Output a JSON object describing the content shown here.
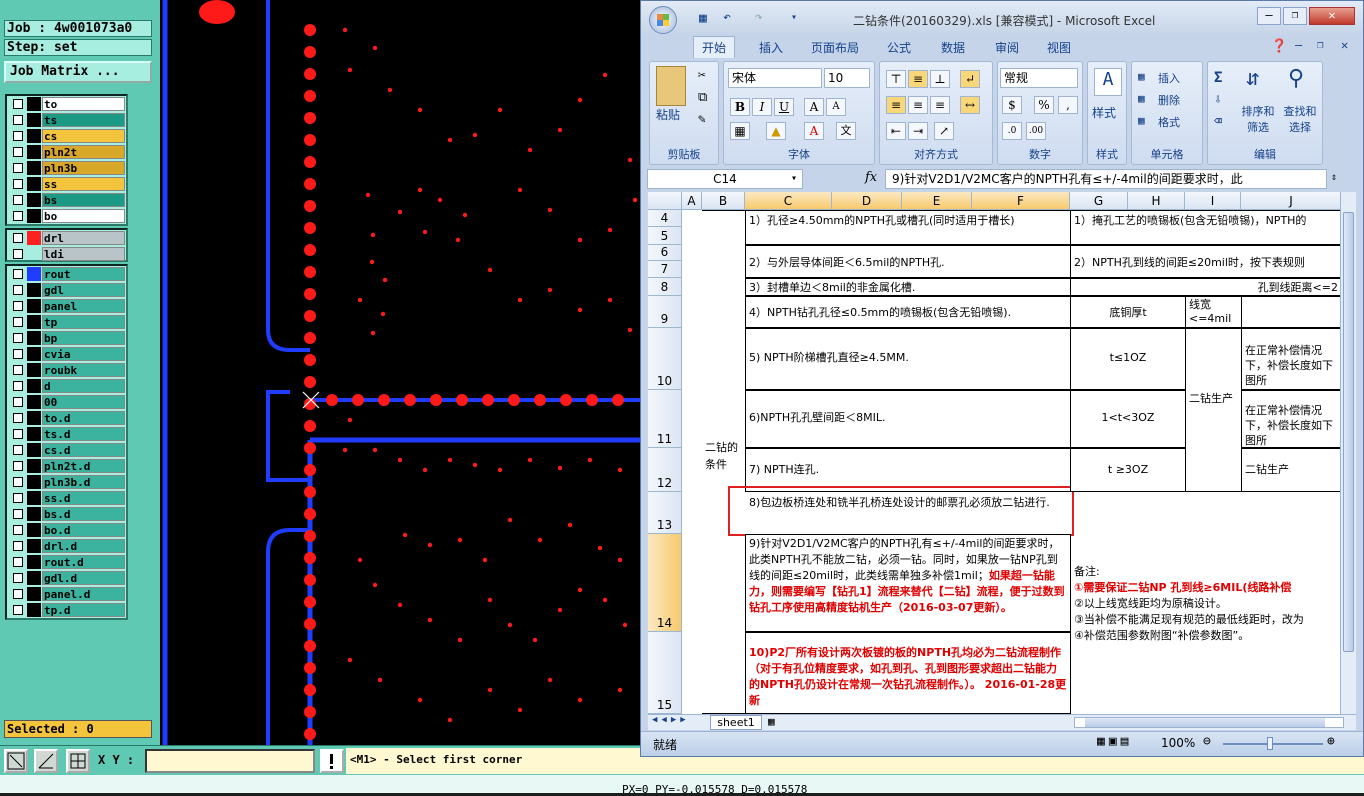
{
  "left_panel": {
    "job": "Job : 4w001073a0",
    "step": "Step: set",
    "job_matrix": "Job Matrix ...",
    "group1": [
      {
        "name": "to",
        "color": "#ffffff"
      },
      {
        "name": "ts",
        "color": "#1c9a86"
      },
      {
        "name": "cs",
        "color": "#f3c43c"
      },
      {
        "name": "pln2t",
        "color": "#d9a72a"
      },
      {
        "name": "pln3b",
        "color": "#d9a72a"
      },
      {
        "name": "ss",
        "color": "#f3c43c"
      },
      {
        "name": "bs",
        "color": "#1c9a86"
      },
      {
        "name": "bo",
        "color": "#ffffff"
      }
    ],
    "group2": [
      {
        "name": "drl",
        "swatch": "#ff2020"
      },
      {
        "name": "ldi",
        "swatch": ""
      }
    ],
    "group3": [
      "rout",
      "gdl",
      "panel",
      "tp",
      "bp",
      "cvia",
      "roubk",
      "d",
      "00",
      "to.d",
      "ts.d",
      "cs.d",
      "pln2t.d",
      "pln3b.d",
      "ss.d",
      "bs.d",
      "bo.d",
      "drl.d",
      "rout.d",
      "gdl.d",
      "panel.d",
      "tp.d"
    ],
    "selected": "Selected : 0"
  },
  "bottom_bar": {
    "xy_label": "X Y :",
    "xy_value": "",
    "prompt": "<M1> - Select first corner",
    "status": "PX=0 PY=-0.015578 D=0.015578"
  },
  "excel": {
    "title": "二钻条件(20160329).xls [兼容模式] - Microsoft Excel",
    "tabs": [
      "开始",
      "插入",
      "页面布局",
      "公式",
      "数据",
      "审阅",
      "视图"
    ],
    "groups": {
      "clipboard": "剪贴板",
      "paste": "粘贴",
      "font": "字体",
      "alignment": "对齐方式",
      "number": "数字",
      "styles": "样式",
      "cells": "单元格",
      "editing": "编辑"
    },
    "font_name": "宋体",
    "font_size": "10",
    "number_format": "常规",
    "insert": "插入",
    "delete": "删除",
    "format": "格式",
    "sort_filter": "排序和 筛选",
    "find_select": "查找和 选择",
    "name_box": "C14",
    "formula": "9)针对V2D1/V2MC客户的NPTH孔有≤+/-4mil的间距要求时，此",
    "columns": [
      "A",
      "B",
      "C",
      "D",
      "E",
      "F",
      "G",
      "H",
      "I",
      "J"
    ],
    "rows": [
      "4",
      "5",
      "6",
      "7",
      "8",
      "9",
      "10",
      "11",
      "12",
      "13",
      "14",
      "15"
    ],
    "cells": {
      "b_merged": "二钻的条件",
      "c4": "1）孔径≥4.50mm的NPTH孔或槽孔(同时适用于槽长)",
      "c6": "2）与外层导体间距＜6.5mil的NPTH孔.",
      "c8": "3）封槽单边＜8mil的非金属化槽.",
      "c9": "4）NPTH钻孔孔径≤0.5mm的喷锡板(包含无铅喷锡).",
      "c10": "5) NPTH阶梯槽孔直径≥4.5MM.",
      "c11": "6)NPTH孔孔壁间距＜8MIL.",
      "c12": "7) NPTH连孔.",
      "c13": "8)包边板桥连处和铣半孔桥连处设计的邮票孔必须放二钻进行.",
      "c14_normal": "9)针对V2D1/V2MC客户的NPTH孔有≤+/-4mil的间距要求时，此类NPTH孔不能放二钻，必须一钻。同时，如果放一钻NP孔到线的间距≤20mil时，此类线需单独多补偿1mil；",
      "c14_red": "如果超一钻能力，则需要编写【钻孔1】流程来替代【二钻】流程，便于过数到钻孔工序使用高精度钻机生产（2016-03-07更新）。",
      "c15": "10)P2厂所有设计两次板镀的板的NPTH孔均必为二钻流程制作（对于有孔位精度要求，如孔到孔、孔到图形要求超出二钻能力的NPTH孔仍设计在常规一次钻孔流程制作。）。    2016-01-28更新",
      "g4": "1）掩孔工艺的喷锡板(包含无铅喷锡)，NPTH的",
      "g6": "2）NPTH孔到线的间距≤20mil时，按下表规则",
      "g8": "孔到线距离<=2",
      "g9": "底铜厚t",
      "h9": "线宽<=4mil",
      "g10": "t≤1OZ",
      "g11": "1<t<3OZ",
      "g12": "t ≥3OZ",
      "h_merged": "二钻生产",
      "j10": "在正常补偿情况下，补偿长度如下图所",
      "j11": "在正常补偿情况下，补偿长度如下图所",
      "j12": "二钻生产",
      "notes_title": "备注:",
      "note1": "①需要保证二钻NP 孔到线≥6MIL(线路补偿",
      "note2": "②以上线宽线距均为原稿设计。",
      "note3": "③当补偿不能满足现有规范的最低线距时，改为",
      "note4": "④补偿范围参数附图“补偿参数图”。"
    },
    "sheet_tab": "sheet1",
    "status_ready": "就绪",
    "zoom": "100%"
  },
  "colors": {
    "panel_bg": "#5fc9b4",
    "drill_red": "#ff1a1a",
    "rout_blue": "#1f3cff",
    "excel_blue": "#15428b"
  }
}
